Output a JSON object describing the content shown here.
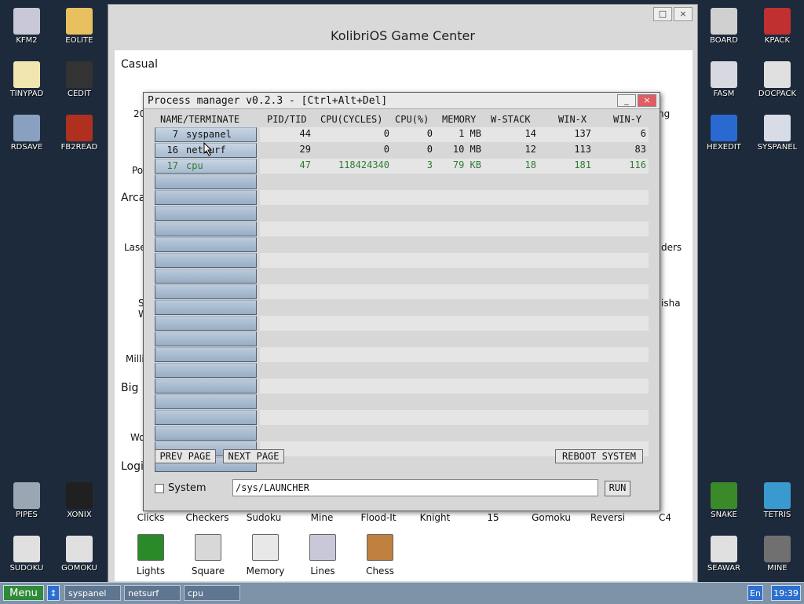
{
  "desktop": {
    "left_icons": [
      {
        "label": "KFM2",
        "icon": "floppy-icon",
        "color": "#c8c8d8"
      },
      {
        "label": "EOLITE",
        "icon": "folder-icon",
        "color": "#e8c060"
      },
      {
        "label": "TINYPAD",
        "icon": "notepad-icon",
        "color": "#f2e6b0"
      },
      {
        "label": "CEDIT",
        "icon": "code-icon",
        "color": "#333333"
      },
      {
        "label": "RDSAVE",
        "icon": "disk-icon",
        "color": "#8aa0c0"
      },
      {
        "label": "FB2READ",
        "icon": "book-icon",
        "color": "#b03020"
      },
      {
        "label": "PIPES",
        "icon": "pipes-icon",
        "color": "#9aa6b2"
      },
      {
        "label": "XONIX",
        "icon": "xonix-icon",
        "color": "#202020"
      },
      {
        "label": "SUDOKU",
        "icon": "sudoku-icon",
        "color": "#e0e0e0"
      },
      {
        "label": "GOMOKU",
        "icon": "gomoku-icon",
        "color": "#e0e0e0"
      }
    ],
    "right_icons": [
      {
        "label": "BOARD",
        "icon": "board-icon",
        "color": "#d0d0d0"
      },
      {
        "label": "KPACK",
        "icon": "hammer-icon",
        "color": "#c03030"
      },
      {
        "label": "FASM",
        "icon": "fasm-icon",
        "color": "#d8d8e0"
      },
      {
        "label": "DOCPACK",
        "icon": "docpack-icon",
        "color": "#e0e0e0"
      },
      {
        "label": "HEXEDIT",
        "icon": "hexedit-icon",
        "color": "#2a6ad0"
      },
      {
        "label": "SYSPANEL",
        "icon": "syspanel-icon",
        "color": "#d8dce6"
      },
      {
        "label": "SNAKE",
        "icon": "snake-icon",
        "color": "#3a8a2a"
      },
      {
        "label": "TETRIS",
        "icon": "tetris-icon",
        "color": "#3a9ad0"
      },
      {
        "label": "SEAWAR",
        "icon": "seawar-icon",
        "color": "#e0e0e0"
      },
      {
        "label": "MINE",
        "icon": "mine-icon",
        "color": "#707070"
      }
    ]
  },
  "game_center": {
    "title": "KolibriOS Game Center",
    "close": "×",
    "maximize": "□",
    "categories": [
      "Casual",
      "Arca",
      "Big",
      "Logic"
    ],
    "partial_labels": {
      "row1_first": "20",
      "row1_last": "ng",
      "row2_first": "Po",
      "arcade_first": "Lase",
      "arcade_last": "ders",
      "s_row_first": "S",
      "s_row_second": "W",
      "s_row_last": "isha",
      "mill": "Milli",
      "big_first": "Wo"
    },
    "games_bottom": [
      "Clicks",
      "Checkers",
      "Sudoku",
      "Mine",
      "Flood-It",
      "Knight",
      "15",
      "Gomoku",
      "Reversi",
      "C4"
    ],
    "games_last": [
      "Lights",
      "Square",
      "Memory",
      "Lines",
      "Chess"
    ]
  },
  "process_manager": {
    "title": "Process manager v0.2.3 - [Ctrl+Alt+Del]",
    "minimize": "_",
    "close": "×",
    "headers": {
      "name": "NAME/TERMINATE",
      "pid": "PID/TID",
      "cycles": "CPU(CYCLES)",
      "cpu_pct": "CPU(%)",
      "memory": "MEMORY",
      "wstack": "W-STACK",
      "winx": "WIN-X",
      "winy": "WIN-Y"
    },
    "processes": [
      {
        "slot": "7",
        "name": "syspanel",
        "pid": "44",
        "cycles": "0",
        "cpu": "0",
        "mem": "1 MB",
        "wstack": "14",
        "winx": "137",
        "winy": "6",
        "color": "#111111"
      },
      {
        "slot": "16",
        "name": "netsurf",
        "pid": "29",
        "cycles": "0",
        "cpu": "0",
        "mem": "10 MB",
        "wstack": "12",
        "winx": "113",
        "winy": "83",
        "color": "#111111"
      },
      {
        "slot": "17",
        "name": "cpu",
        "pid": "47",
        "cycles": "118424340",
        "cpu": "3",
        "mem": "79 KB",
        "wstack": "18",
        "winx": "181",
        "winy": "116",
        "color": "#2e7d32"
      }
    ],
    "empty_rows": 19,
    "buttons": {
      "prev": "PREV PAGE",
      "next": "NEXT PAGE",
      "reboot": "REBOOT SYSTEM",
      "run": "RUN"
    },
    "system_checkbox_label": "System",
    "command_value": "/sys/LAUNCHER"
  },
  "taskbar": {
    "menu": "Menu",
    "tasks": [
      "syspanel",
      "netsurf",
      "cpu"
    ],
    "lang": "En",
    "clock": "19:39"
  }
}
